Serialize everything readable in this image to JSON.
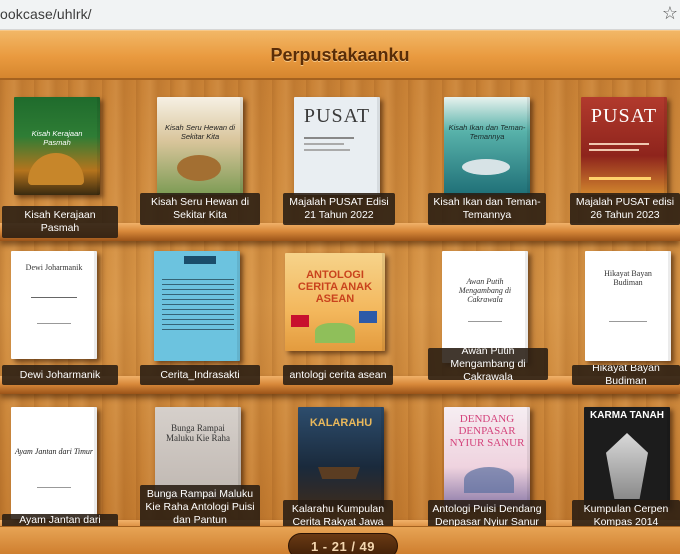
{
  "browser": {
    "address": "ookcase/uhlrk/"
  },
  "header": {
    "title": "Perpustakaanku"
  },
  "shelves": [
    {
      "books": [
        {
          "caption": "Kisah Kerajaan Pasmah",
          "cover_text": "Kisah Kerajaan Pasmah",
          "cover_color": "#2b6a32"
        },
        {
          "caption": "Kisah Seru Hewan di Sekitar Kita",
          "cover_text": "Kisah Seru Hewan di Sekitar Kita",
          "cover_color": "#b98a52"
        },
        {
          "caption": "Majalah PUSAT Edisi 21 Tahun 2022",
          "cover_text": "PUSAT",
          "cover_color": "#e9eef2"
        },
        {
          "caption": "Kisah Ikan dan Teman-Temannya",
          "cover_text": "Kisah Ikan dan Teman-Temannya",
          "cover_color": "#2f8c8a"
        },
        {
          "caption": "Majalah PUSAT edisi 26 Tahun 2023",
          "cover_text": "PUSAT",
          "cover_color": "#9a2b23"
        }
      ]
    },
    {
      "books": [
        {
          "caption": "Dewi Joharmanik",
          "cover_text": "Dewi Joharmanik",
          "cover_color": "#ffffff"
        },
        {
          "caption": "Cerita_Indrasakti",
          "cover_text": "",
          "cover_color": "#6cc3df"
        },
        {
          "caption": "antologi cerita asean",
          "cover_text": "ANTOLOGI CERITA ANAK ASEAN",
          "cover_color": "#f3c26a"
        },
        {
          "caption": "Awan Putih Mengambang di Cakrawala",
          "cover_text": "Awan Putih Mengambang di Cakrawala",
          "cover_color": "#ffffff"
        },
        {
          "caption": "Hikayat Bayan Budiman",
          "cover_text": "Hikayat Bayan Budiman",
          "cover_color": "#ffffff"
        }
      ]
    },
    {
      "books": [
        {
          "caption": "Ayam Jantan dari Timur",
          "cover_text": "Ayam Jantan dari Timur",
          "cover_color": "#ffffff"
        },
        {
          "caption": "Bunga Rampai Maluku Kie Raha Antologi Puisi dan Pantun",
          "cover_text": "Bunga Rampai Maluku Kie Raha",
          "cover_color": "#c9c2bd"
        },
        {
          "caption": "Kalarahu Kumpulan Cerita Rakyat Jawa",
          "cover_text": "KALARAHU",
          "cover_color": "#23364f"
        },
        {
          "caption": "Antologi Puisi Dendang Denpasar Nyiur Sanur",
          "cover_text": "DENDANG DENPASAR NYIUR SANUR",
          "cover_color": "#f2e6ee"
        },
        {
          "caption": "Kumpulan Cerpen Kompas 2014",
          "cover_text": "KARMA TANAH",
          "cover_color": "#1c1c1c"
        }
      ]
    }
  ],
  "pager": {
    "text": "1 - 21 / 49"
  }
}
